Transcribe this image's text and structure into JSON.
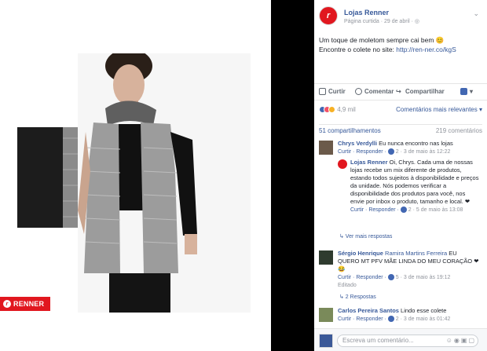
{
  "brand": {
    "badge_label": "RENNER"
  },
  "post": {
    "page_name": "Lojas Renner",
    "meta": "Página curtida · 29 de abril · ",
    "text_line1": "Um toque de moletom sempre cai bem 😊",
    "text_line2_prefix": "Encontre o colete no site: ",
    "text_link": "http://ren-ner.co/kgS"
  },
  "actions": {
    "like": "Curtir",
    "comment": "Comentar",
    "share": "Compartilhar"
  },
  "reactions": {
    "count": "4,9 mil",
    "relevance": "Comentários mais relevantes ▾"
  },
  "counts": {
    "shares": "51 compartilhamentos",
    "comments": "219 comentários"
  },
  "comments": [
    {
      "author": "Chrys Verdylli",
      "text": "Eu nunca encontro nas lojas",
      "actions": "Curtir · Responder · ",
      "likes": "2",
      "time": " · 3 de maio às 12:22"
    },
    {
      "author": "Lojas Renner",
      "text": "Oi, Chrys. Cada uma de nossas lojas recebe um mix diferente de produtos, estando todos sujeitos à disponibilidade e preços da unidade. Nós podemos verificar a disponibilidade dos produtos para você, nos envie por inbox o produto, tamanho e local. ❤",
      "actions": "Curtir · Responder · ",
      "likes": "2",
      "time": " · 5 de maio às 13:08"
    },
    {
      "more_replies": "↳ Ver mais respostas"
    },
    {
      "author": "Sérgio Henrique",
      "tag": "Ramira Martins Ferreira",
      "text": " EU QUERO MT PFV MÃE LINDA DO MEU CORAÇÃO ❤😂",
      "actions": "Curtir · Responder · ",
      "likes": "5",
      "time": " · 3 de maio às 19:12",
      "edited": "Editado"
    },
    {
      "replies": "↳ 2 Respostas"
    },
    {
      "author": "Carlos Pereira Santos",
      "text": " Lindo esse colete",
      "actions": "Curtir · Responder · ",
      "likes": "2",
      "time": " · 3 de maio às 01:42"
    }
  ],
  "composer": {
    "placeholder": "Escreva um comentário..."
  },
  "colors": {
    "brand_red": "#e1171f",
    "link_blue": "#365899",
    "fb_blue": "#4267b2"
  }
}
